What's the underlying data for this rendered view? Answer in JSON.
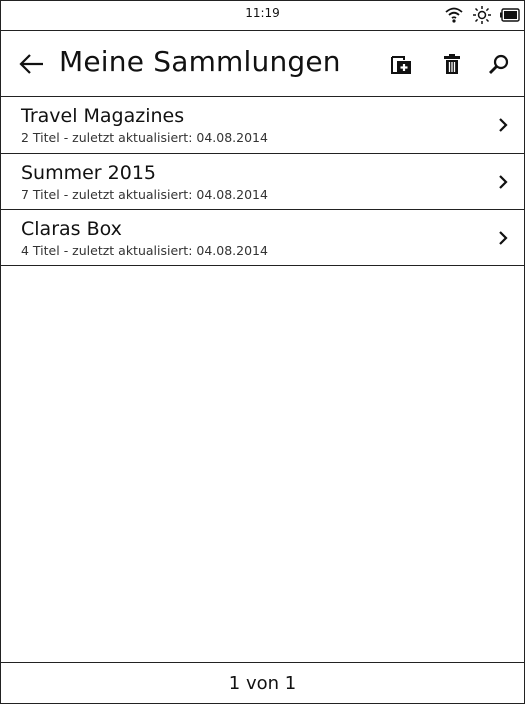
{
  "status_bar": {
    "time": "11:19",
    "icons": [
      "wifi-icon",
      "brightness-icon",
      "battery-icon"
    ]
  },
  "header": {
    "title": "Meine Sammlungen",
    "actions": [
      "back-arrow-icon",
      "add-collection-icon",
      "trash-icon",
      "search-icon"
    ]
  },
  "collections": [
    {
      "title": "Travel Magazines",
      "meta": "2 Titel - zuletzt aktualisiert: 04.08.2014"
    },
    {
      "title": "Summer 2015",
      "meta": "7 Titel - zuletzt aktualisiert: 04.08.2014"
    },
    {
      "title": "Claras Box",
      "meta": "4 Titel - zuletzt aktualisiert: 04.08.2014"
    }
  ],
  "footer": {
    "pagination": "1 von 1"
  },
  "colors": {
    "foreground": "#111111",
    "background": "#ffffff",
    "border": "#222222"
  }
}
